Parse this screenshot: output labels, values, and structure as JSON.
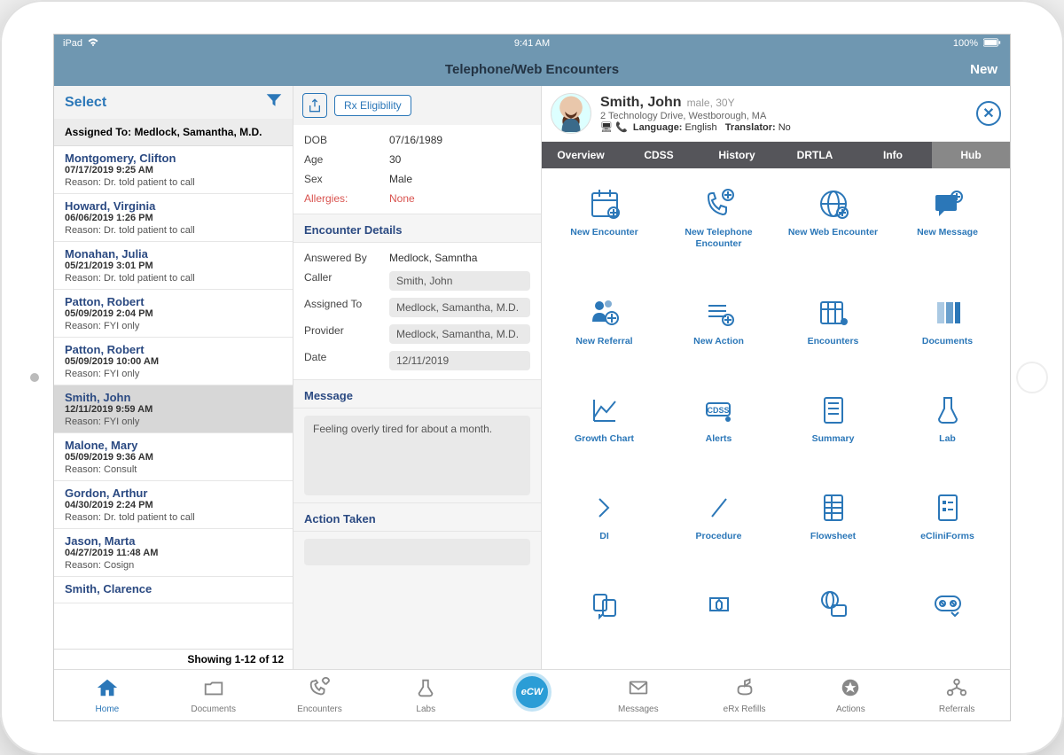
{
  "status_bar": {
    "device": "iPad",
    "time": "9:41 AM",
    "battery": "100%"
  },
  "header": {
    "title": "Telephone/Web Encounters",
    "new_label": "New"
  },
  "list": {
    "select_label": "Select",
    "assigned_label": "Assigned To: Medlock, Samantha, M.D.",
    "showing": "Showing 1-12 of 12",
    "items": [
      {
        "name": "Montgomery, Clifton",
        "dt": "07/17/2019 9:25 AM",
        "reason": "Reason: Dr. told patient to call",
        "sel": false
      },
      {
        "name": "Howard, Virginia",
        "dt": "06/06/2019 1:26 PM",
        "reason": "Reason: Dr. told patient to call",
        "sel": false
      },
      {
        "name": "Monahan, Julia",
        "dt": "05/21/2019 3:01 PM",
        "reason": "Reason: Dr. told patient to call",
        "sel": false
      },
      {
        "name": "Patton, Robert",
        "dt": "05/09/2019 2:04 PM",
        "reason": "Reason: FYI only",
        "sel": false
      },
      {
        "name": "Patton, Robert",
        "dt": "05/09/2019 10:00 AM",
        "reason": "Reason: FYI only",
        "sel": false
      },
      {
        "name": "Smith, John",
        "dt": "12/11/2019 9:59 AM",
        "reason": "Reason: FYI only",
        "sel": true
      },
      {
        "name": "Malone, Mary",
        "dt": "05/09/2019 9:36 AM",
        "reason": "Reason: Consult",
        "sel": false
      },
      {
        "name": "Gordon, Arthur",
        "dt": "04/30/2019 2:24 PM",
        "reason": "Reason: Dr. told patient to call",
        "sel": false
      },
      {
        "name": "Jason, Marta",
        "dt": "04/27/2019 11:48 AM",
        "reason": "Reason: Cosign",
        "sel": false
      },
      {
        "name": "Smith, Clarence",
        "dt": "",
        "reason": "",
        "sel": false
      }
    ]
  },
  "detail": {
    "rx_label": "Rx Eligibility",
    "dob_k": "DOB",
    "dob_v": "07/16/1989",
    "age_k": "Age",
    "age_v": "30",
    "sex_k": "Sex",
    "sex_v": "Male",
    "allerg_k": "Allergies:",
    "allerg_v": "None",
    "enc_title": "Encounter Details",
    "answered_k": "Answered By",
    "answered_v": "Medlock, Samntha",
    "caller_k": "Caller",
    "caller_v": "Smith, John",
    "assigned_k": "Assigned To",
    "assigned_v": "Medlock, Samantha, M.D.",
    "provider_k": "Provider",
    "provider_v": "Medlock, Samantha, M.D.",
    "date_k": "Date",
    "date_v": "12/11/2019",
    "msg_title": "Message",
    "msg_text": "Feeling overly tired for about a month.",
    "action_title": "Action Taken"
  },
  "hub": {
    "patient_name": "Smith, John",
    "demo": "male, 30Y",
    "addr": "2 Technology Drive, Westborough, MA",
    "lang_label": "Language:",
    "lang_val": "English",
    "trans_label": "Translator:",
    "trans_val": "No",
    "tabs": [
      {
        "label": "Overview"
      },
      {
        "label": "CDSS"
      },
      {
        "label": "History"
      },
      {
        "label": "DRTLA"
      },
      {
        "label": "Info"
      },
      {
        "label": "Hub",
        "active": true
      }
    ],
    "tiles": [
      "New Encounter",
      "New Telephone Encounter",
      "New Web Encounter",
      "New Message",
      "New Referral",
      "New Action",
      "Encounters",
      "Documents",
      "Growth Chart",
      "Alerts",
      "Summary",
      "Lab",
      "DI",
      "Procedure",
      "Flowsheet",
      "eCliniForms",
      "",
      "",
      "",
      ""
    ]
  },
  "bottom": {
    "tabs": [
      {
        "label": "Home",
        "active": true
      },
      {
        "label": "Documents"
      },
      {
        "label": "Encounters"
      },
      {
        "label": "Labs"
      },
      {
        "label": "eCW",
        "center": true
      },
      {
        "label": "Messages"
      },
      {
        "label": "eRx Refills"
      },
      {
        "label": "Actions"
      },
      {
        "label": "Referrals"
      }
    ]
  }
}
